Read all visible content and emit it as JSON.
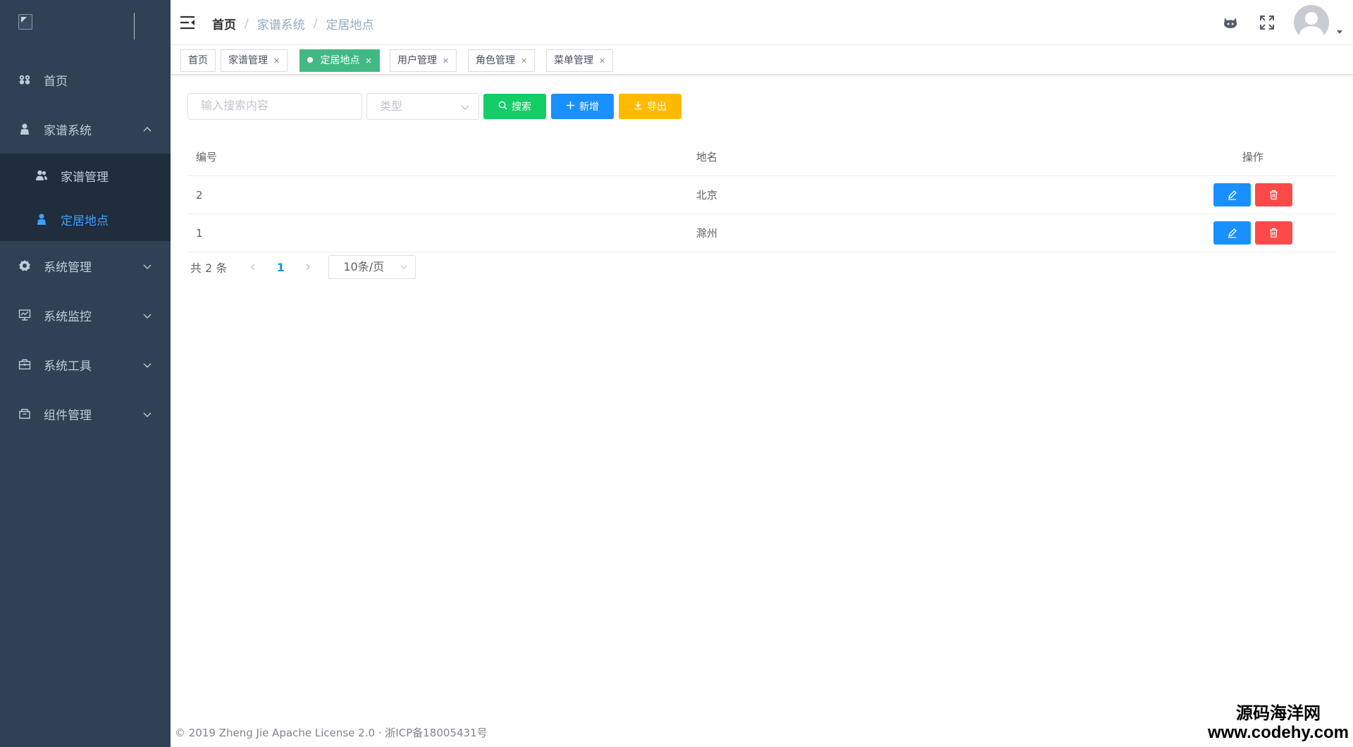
{
  "sidebar": {
    "menu": [
      {
        "label": "首页",
        "icon": "dashboard-icon"
      },
      {
        "label": "家谱系统",
        "icon": "user-icon",
        "expanded": true,
        "children": [
          {
            "label": "家谱管理",
            "icon": "peoples-icon"
          },
          {
            "label": "定居地点",
            "icon": "user-icon",
            "active": true
          }
        ]
      },
      {
        "label": "系统管理",
        "icon": "gear-icon"
      },
      {
        "label": "系统监控",
        "icon": "monitor-icon"
      },
      {
        "label": "系统工具",
        "icon": "toolbox-icon"
      },
      {
        "label": "组件管理",
        "icon": "component-icon"
      }
    ]
  },
  "navbar": {
    "breadcrumb": [
      "首页",
      "家谱系统",
      "定居地点"
    ]
  },
  "tags": [
    {
      "label": "首页",
      "closable": false
    },
    {
      "label": "家谱管理",
      "closable": true
    },
    {
      "label": "定居地点",
      "closable": true,
      "active": true
    },
    {
      "label": "用户管理",
      "closable": true
    },
    {
      "label": "角色管理",
      "closable": true
    },
    {
      "label": "菜单管理",
      "closable": true
    }
  ],
  "filter": {
    "search_placeholder": "输入搜索内容",
    "type_placeholder": "类型",
    "search_label": "搜索",
    "add_label": "新增",
    "export_label": "导出"
  },
  "table": {
    "headers": {
      "id": "编号",
      "name": "地名",
      "op": "操作"
    },
    "rows": [
      {
        "id": "2",
        "name": "北京"
      },
      {
        "id": "1",
        "name": "滁州"
      }
    ]
  },
  "pagination": {
    "total": "共 2 条",
    "current": "1",
    "page_size": "10条/页"
  },
  "footer": "© 2019 Zheng Jie Apache License 2.0 · 浙ICP备18005431号",
  "watermark": {
    "line1": "源码海洋网",
    "line2": "www.codehy.com"
  },
  "colors": {
    "sidebar_bg": "#304156",
    "submenu_bg": "#1f2d3d",
    "active_menu": "#409eff",
    "active_tag": "#42b983",
    "search_btn": "#13ce66",
    "add_btn": "#1890ff",
    "export_btn": "#ffba00",
    "delete_btn": "#ff4949"
  }
}
